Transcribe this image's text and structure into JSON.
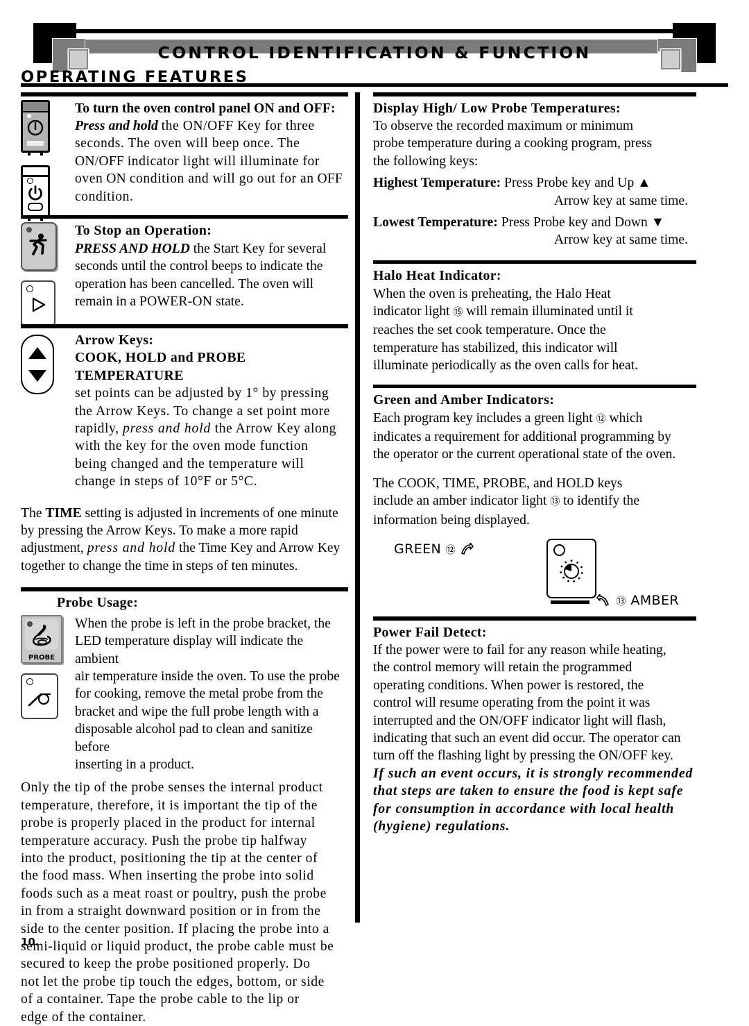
{
  "header": {
    "title": "CONTROL IDENTIFICATION & FUNCTION",
    "page_title": "OPERATING FEATURES"
  },
  "page_number": "10.",
  "left_column": {
    "on_off": {
      "heading_bold": "To turn the oven control panel",
      "sc_on": "ON",
      "and": "and",
      "sc_off": "OFF",
      "colon": ":",
      "press_hold_italic": "Press and hold",
      "line2": "the ON/OFF Key for three",
      "line3": "seconds.  The oven will beep once.  The",
      "sc_onoff": "ON/OFF",
      "line4": "indicator light will illuminate for",
      "line5_a": "oven",
      "sc_on2": "ON",
      "line5_b": "condition and will go out for an",
      "sc_off2": "OFF",
      "line6": "condition.",
      "icon_names": [
        "onoff-key-gray-icon",
        "onoff-key-white-icon"
      ]
    },
    "stop_operation": {
      "heading": "To Stop an Operation:",
      "emph": "PRESS AND HOLD",
      "body1": "the Start Key for several",
      "body2": "seconds until the control beeps to indicate the",
      "body3": "operation has been cancelled.  The oven will",
      "body4_a": "remain in a",
      "sc_power_on": "POWER-ON",
      "body4_b": "state.",
      "icon_names": [
        "start-key-icon",
        "start-play-key-icon"
      ]
    },
    "arrow_keys": {
      "heading": "Arrow Keys:",
      "subheading": "COOK, HOLD and PROBE TEMPERATURE",
      "body1": "set points can be adjusted by 1° by pressing",
      "body2": "the Arrow Keys.  To change a set point more",
      "body3_a": "rapidly,",
      "body3_ital": "press and hold",
      "body3_b": "the Arrow Key along",
      "body4": "with the key for the oven mode function",
      "body5": "being changed and the temperature will",
      "body6": "change in steps of 10°F or 5°C.",
      "icon_name": "arrow-keys-icon"
    },
    "time_paragraph": {
      "part1": "The",
      "bold": "TIME",
      "part2": "setting is adjusted in increments of one minute",
      "part3": "by pressing the Arrow Keys.  To make a more rapid",
      "part4_a": "adjustment,",
      "part4_ital": "press and hold",
      "part4_b": "the Time Key and Arrow Key",
      "part5": "together to change the time in steps of ten minutes."
    },
    "probe_usage": {
      "heading": "Probe Usage:",
      "body1": "When the probe is left in the probe bracket, the",
      "body2": "LED temperature display will indicate the ambient",
      "body3": "air temperature inside the oven.  To use the probe",
      "body4": "for cooking, remove the metal probe from the",
      "body5": "bracket and wipe the full probe length with a",
      "body6": "disposable alcohol pad to clean and sanitize before",
      "body7": "inserting in a product.",
      "key_label": "PROBE",
      "icon_names": [
        "probe-key-icon",
        "probe-plain-key-icon"
      ]
    },
    "probe_tip_paragraph": {
      "l1": "Only the tip of the probe senses the internal product",
      "l2": "temperature, therefore, it is important the tip of the",
      "l3": "probe is properly placed in the product for internal",
      "l4": "temperature accuracy.  Push the probe tip halfway",
      "l5": "into the product, positioning the tip at the center of",
      "l6": "the food mass.  When inserting the probe into solid",
      "l7": "foods such as a meat roast or poultry, push the probe",
      "l8": "in from a straight downward position or in from the",
      "l9": "side to the center position.  If placing the probe into a",
      "l10": "semi-liquid or liquid product, the probe cable must be",
      "l11": "secured to keep the probe positioned properly.  Do",
      "l12": "not let the probe tip touch the edges, bottom, or side",
      "l13": "of a container.  Tape the probe cable to the lip or",
      "l14": "edge of the container."
    }
  },
  "right_column": {
    "display_high_low": {
      "heading": "Display High/ Low Probe Temperatures:",
      "body1": "To observe the recorded maximum or minimum",
      "body2": "probe temperature during a cooking program, press",
      "body3": "the following keys:",
      "highest_label": "Highest Temperature:",
      "highest_body1": "Press Probe key and Up ▲",
      "highest_body2": "Arrow key at same time.",
      "lowest_label": "Lowest Temperature:",
      "lowest_body1": "Press Probe key and Down ▼",
      "lowest_body2": "Arrow key at same time."
    },
    "halo_heat": {
      "heading": "Halo Heat Indicator:",
      "body1": "When the oven is preheating, the Halo Heat",
      "body2_a": "indicator light",
      "marker_15": "⑮",
      "body2_b": "will remain illuminated until it",
      "body3": "reaches the set cook temperature.  Once the",
      "body4": "temperature has stabilized, this indicator will",
      "body5": "illuminate periodically as the oven calls for heat."
    },
    "green_amber": {
      "heading": "Green and Amber Indicators:",
      "body1_a": "Each program key includes a green light",
      "marker_12": "⑫",
      "body1_b": "which",
      "body2": "indicates a requirement for additional programming by",
      "body3": "the operator or the current operational state of the oven.",
      "body4": "The COOK, TIME, PROBE, and HOLD keys",
      "body5_a": "include an amber indicator light",
      "marker_13": "⑬",
      "body5_b": "to identify the",
      "body6": "information being displayed.",
      "diagram": {
        "green_label": "GREEN",
        "green_marker": "⑫",
        "amber_marker": "⑬",
        "amber_label": "AMBER",
        "key_icon_name": "program-key-diagram-icon"
      }
    },
    "power_fail": {
      "heading": "Power Fail Detect:",
      "body1": "If the power were to fail for any reason while heating,",
      "body2": "the control memory will retain the programmed",
      "body3": "operating conditions.  When power is restored, the",
      "body4": "control will resume operating from the point it was",
      "body5_a": "interrupted and the",
      "sc_onoff": "ON/OFF",
      "body5_b": "indicator light will flash,",
      "body6": "indicating that such an event did occur.  The operator can",
      "body7_a": "turn off the flashing light by pressing the",
      "sc_onoff2": "ON/OFF",
      "body7_b": "key.",
      "italic1": "If such an event occurs, it is strongly recommended",
      "italic2": "that steps are taken to ensure the food is kept safe",
      "italic3": "for consumption in accordance with local health",
      "italic4": "(hygiene) regulations."
    }
  },
  "colors": {
    "ink": "#000000",
    "key_gray": "#b3b3b3",
    "ornament_gray": "#7b7b7b",
    "ornament_light": "#cfcfcf"
  }
}
